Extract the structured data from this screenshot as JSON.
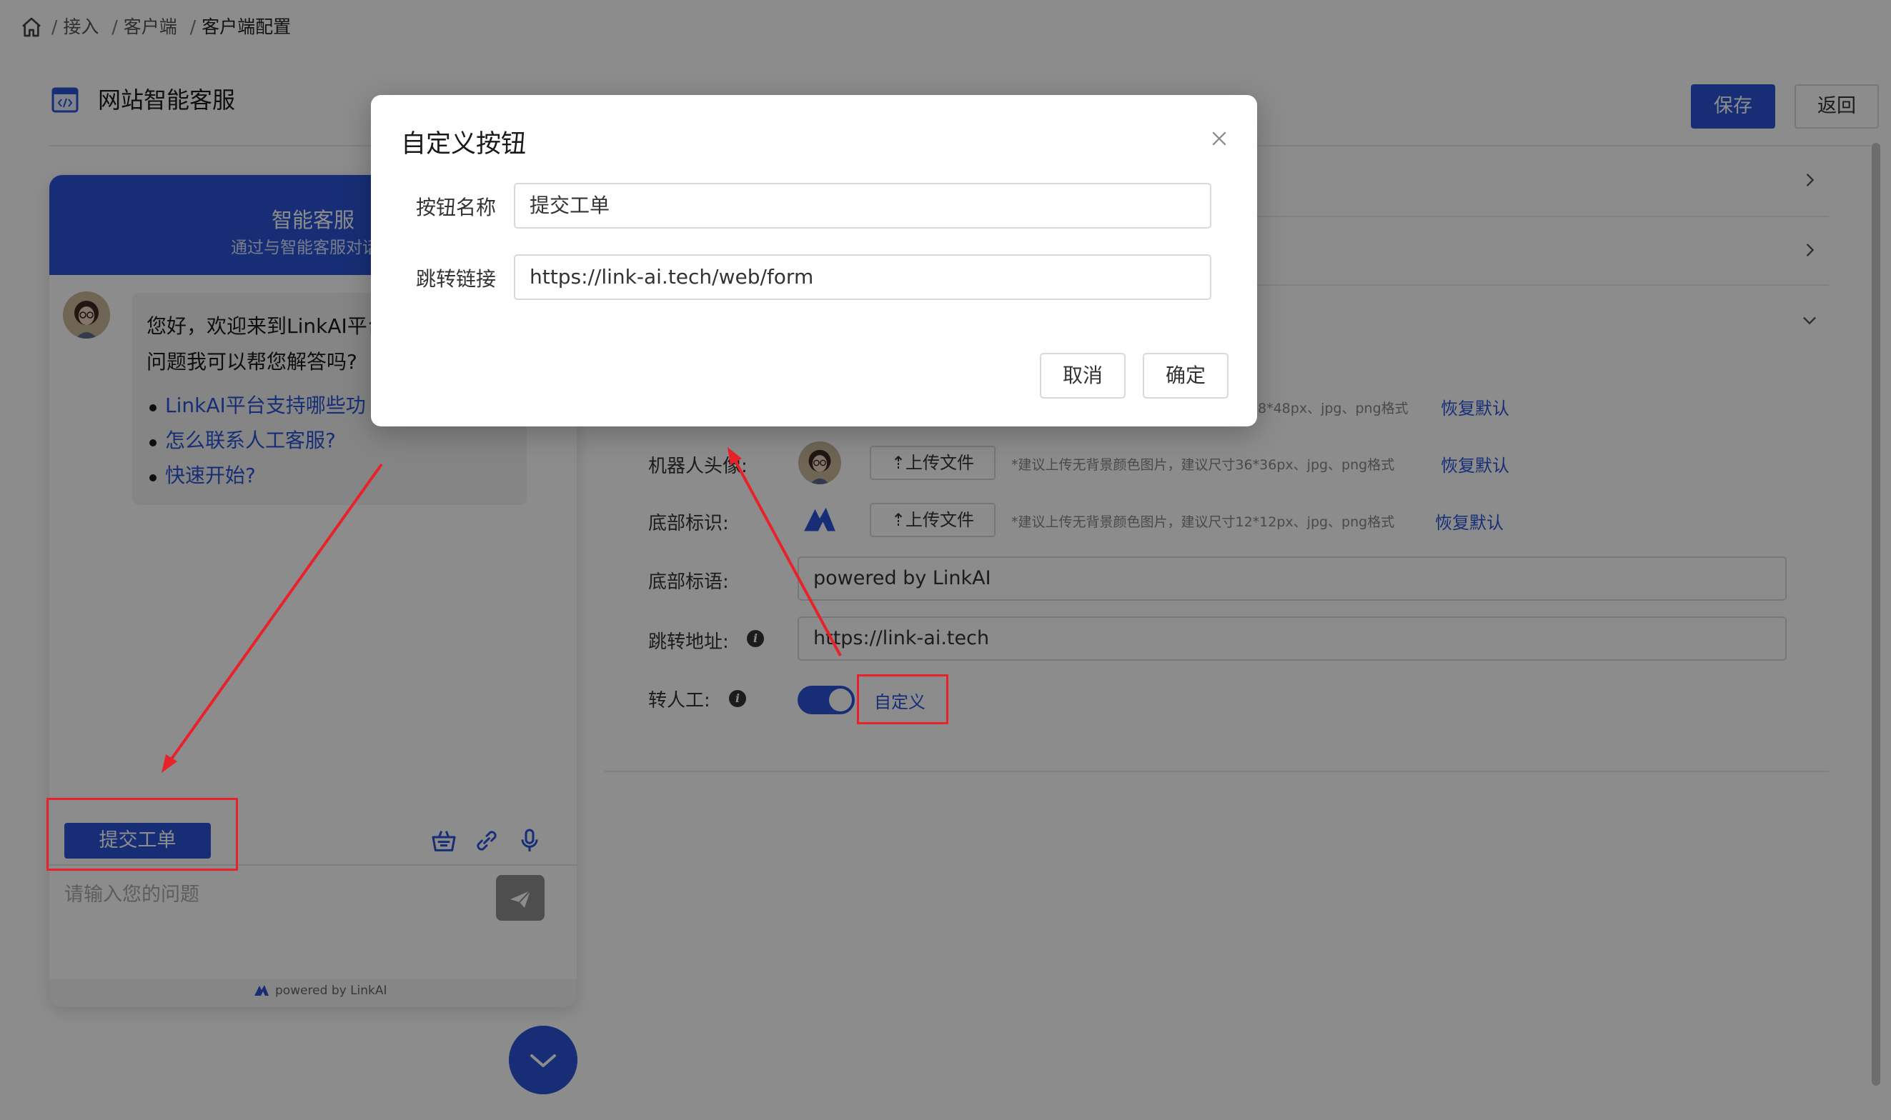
{
  "breadcrumb": {
    "separator": "/",
    "items": [
      "接入",
      "客户端",
      "客户端配置"
    ]
  },
  "header": {
    "title": "网站智能客服",
    "save_label": "保存",
    "back_label": "返回"
  },
  "widget": {
    "title": "智能客服",
    "subtitle": "通过与智能客服对话获",
    "greeting_line1": "您好，欢迎来到LinkAI平台",
    "greeting_line2": "问题我可以帮您解答吗?",
    "faq": [
      "LinkAI平台支持哪些功",
      "怎么联系人工客服?",
      "快速开始?"
    ],
    "submit_button": "提交工单",
    "input_placeholder": "请输入您的问题",
    "footer": "powered by LinkAI"
  },
  "settings": {
    "hint_top": "8*48px、jpg、png格式",
    "restore_label": "恢复默认",
    "upload_label": "上传文件",
    "robot_avatar_label": "机器人头像:",
    "robot_avatar_hint": "*建议上传无背景颜色图片，建议尺寸36*36px、jpg、png格式",
    "bottom_logo_label": "底部标识:",
    "bottom_logo_hint": "*建议上传无背景颜色图片，建议尺寸12*12px、jpg、png格式",
    "bottom_slogan_label": "底部标语:",
    "bottom_slogan_value": "powered by LinkAI",
    "jump_url_label": "跳转地址:",
    "jump_url_value": "https://link-ai.tech",
    "transfer_label": "转人工:",
    "transfer_enabled": true,
    "custom_label": "自定义"
  },
  "modal": {
    "title": "自定义按钮",
    "name_label": "按钮名称",
    "name_value": "提交工单",
    "link_label": "跳转链接",
    "link_value": "https://link-ai.tech/web/form",
    "cancel_label": "取消",
    "confirm_label": "确定"
  },
  "colors": {
    "primary": "#2a55d8",
    "annotation_red": "#e8222a",
    "overlay": "rgba(0,0,0,0.45)"
  },
  "icons": [
    "home-icon",
    "app-window-icon",
    "chevron-right-icon",
    "chevron-down-icon",
    "basket-icon",
    "link-icon",
    "microphone-icon",
    "send-icon",
    "upload-icon",
    "linkai-logo-icon",
    "info-icon",
    "close-icon"
  ]
}
